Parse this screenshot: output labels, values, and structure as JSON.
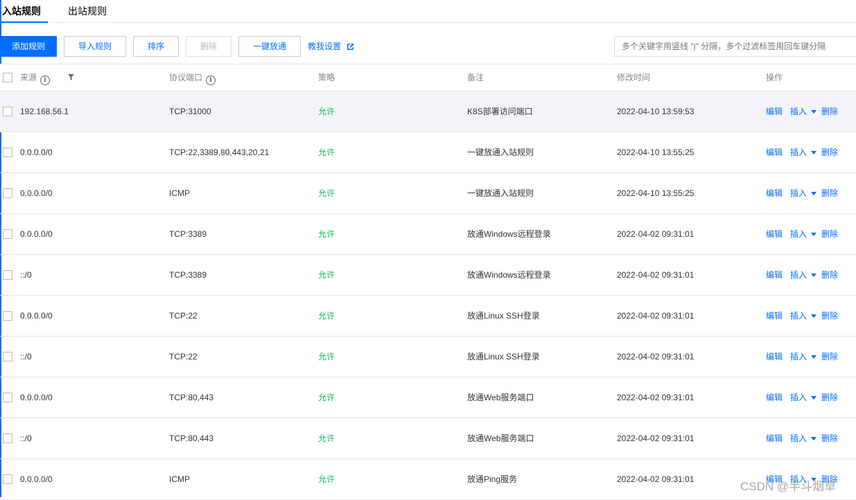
{
  "tabs": [
    {
      "label": "入站规则"
    },
    {
      "label": "出站规则"
    }
  ],
  "toolbar": {
    "add_label": "添加规则",
    "import_label": "导入规则",
    "sort_label": "排序",
    "delete_label": "删除",
    "open_all_label": "一键放通",
    "help_label": "教我设置",
    "search_placeholder": "多个关键字用竖线 \"|\" 分隔，多个过滤标签用回车键分隔"
  },
  "table": {
    "headers": {
      "source": "来源",
      "protocol_port": "协议端口",
      "policy": "策略",
      "remark": "备注",
      "modified": "修改时间",
      "actions": "操作"
    },
    "action_labels": {
      "edit": "编辑",
      "insert": "插入",
      "delete": "删除"
    },
    "rows": [
      {
        "source": "192.168.56.1",
        "protocol_port": "TCP:31000",
        "policy": "允许",
        "remark": "K8S部署访问端口",
        "modified": "2022-04-10 13:59:53"
      },
      {
        "source": "0.0.0.0/0",
        "protocol_port": "TCP:22,3389,80,443,20,21",
        "policy": "允许",
        "remark": "一键放通入站规则",
        "modified": "2022-04-10 13:55:25"
      },
      {
        "source": "0.0.0.0/0",
        "protocol_port": "ICMP",
        "policy": "允许",
        "remark": "一键放通入站规则",
        "modified": "2022-04-10 13:55:25"
      },
      {
        "source": "0.0.0.0/0",
        "protocol_port": "TCP:3389",
        "policy": "允许",
        "remark": "放通Windows远程登录",
        "modified": "2022-04-02 09:31:01"
      },
      {
        "source": "::/0",
        "protocol_port": "TCP:3389",
        "policy": "允许",
        "remark": "放通Windows远程登录",
        "modified": "2022-04-02 09:31:01"
      },
      {
        "source": "0.0.0.0/0",
        "protocol_port": "TCP:22",
        "policy": "允许",
        "remark": "放通Linux SSH登录",
        "modified": "2022-04-02 09:31:01"
      },
      {
        "source": "::/0",
        "protocol_port": "TCP:22",
        "policy": "允许",
        "remark": "放通Linux SSH登录",
        "modified": "2022-04-02 09:31:01"
      },
      {
        "source": "0.0.0.0/0",
        "protocol_port": "TCP:80,443",
        "policy": "允许",
        "remark": "放通Web服务端口",
        "modified": "2022-04-02 09:31:01"
      },
      {
        "source": "::/0",
        "protocol_port": "TCP:80,443",
        "policy": "允许",
        "remark": "放通Web服务端口",
        "modified": "2022-04-02 09:31:01"
      },
      {
        "source": "0.0.0.0/0",
        "protocol_port": "ICMP",
        "policy": "允许",
        "remark": "放通Ping服务",
        "modified": "2022-04-02 09:31:01"
      }
    ]
  },
  "watermark": "CSDN @半斗烟草",
  "colors": {
    "accent": "#006eff",
    "allow": "#0abf5b"
  }
}
